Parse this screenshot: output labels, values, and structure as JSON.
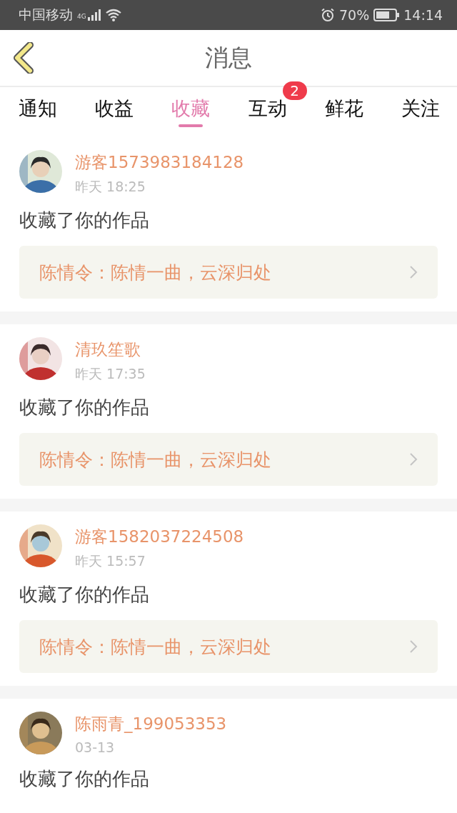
{
  "status_bar": {
    "carrier": "中国移动",
    "network": "4G",
    "battery": "70%",
    "time": "14:14"
  },
  "header": {
    "title": "消息"
  },
  "tabs": [
    {
      "label": "通知",
      "selected": false
    },
    {
      "label": "收益",
      "selected": false
    },
    {
      "label": "收藏",
      "selected": true
    },
    {
      "label": "互动",
      "selected": false,
      "badge": "2"
    },
    {
      "label": "鲜花",
      "selected": false
    },
    {
      "label": "关注",
      "selected": false
    }
  ],
  "messages": [
    {
      "user": "游客1573983184128",
      "time": "昨天 18:25",
      "action": "收藏了你的作品",
      "work": "陈情令：陈情一曲，云深归处"
    },
    {
      "user": "清玖笙歌",
      "time": "昨天 17:35",
      "action": "收藏了你的作品",
      "work": "陈情令：陈情一曲，云深归处"
    },
    {
      "user": "游客1582037224508",
      "time": "昨天 15:57",
      "action": "收藏了你的作品",
      "work": "陈情令：陈情一曲，云深归处"
    },
    {
      "user": "陈雨青_199053353",
      "time": "03-13",
      "action": "收藏了你的作品"
    }
  ]
}
